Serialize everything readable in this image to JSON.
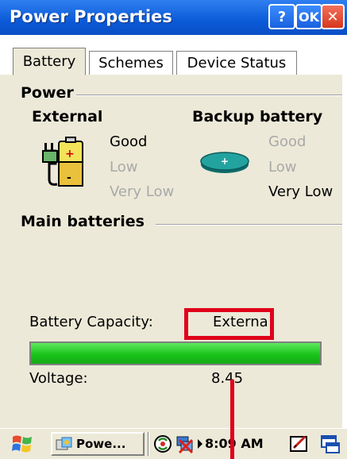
{
  "window": {
    "title": "Power Properties",
    "help_label": "?",
    "ok_label": "OK",
    "close_label": "✕"
  },
  "tabs": [
    {
      "label": "Battery",
      "active": true
    },
    {
      "label": "Schemes",
      "active": false
    },
    {
      "label": "Device Status",
      "active": false
    }
  ],
  "power": {
    "heading": "Power",
    "external": {
      "heading": "External",
      "levels": [
        "Good",
        "Low",
        "Very Low"
      ],
      "current": "Good"
    },
    "backup": {
      "heading": "Backup battery",
      "levels": [
        "Good",
        "Low",
        "Very Low"
      ],
      "current": "Very Low"
    }
  },
  "main_batteries": {
    "heading": "Main batteries",
    "capacity_label": "Battery Capacity:",
    "capacity_value": "Externa",
    "progress_percent": 100,
    "voltage_label": "Voltage:",
    "voltage_value": "8.45"
  },
  "taskbar": {
    "app_label": "Powe...",
    "time": "8:09 AM"
  },
  "colors": {
    "titlebar": "#0b5ad8",
    "panel": "#ece9d8",
    "progress": "#1bc41b",
    "highlight": "#e0001a"
  }
}
